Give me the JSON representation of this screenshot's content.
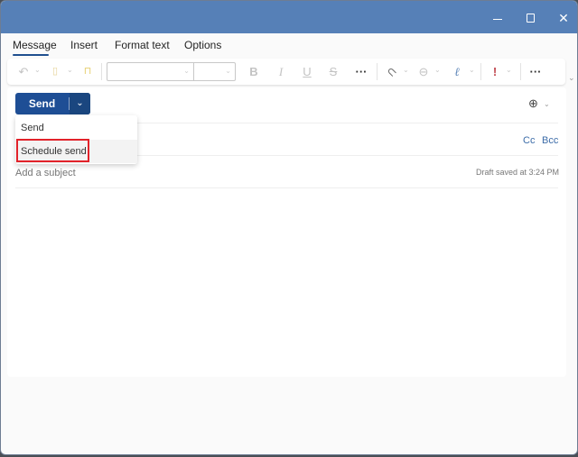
{
  "window": {
    "controls": {
      "minimize": "minimize",
      "maximize": "maximize",
      "close": "close"
    },
    "titlebar_color": "#5680b7"
  },
  "tabs": [
    {
      "label": "Message",
      "active": true
    },
    {
      "label": "Insert",
      "active": false
    },
    {
      "label": "Format text",
      "active": false
    },
    {
      "label": "Options",
      "active": false
    }
  ],
  "ribbon": {
    "icons": {
      "undo": "↶",
      "paste": "📋",
      "format_painter": "🖌",
      "bold": "B",
      "italic": "I",
      "underline": "U",
      "strikethrough": "S",
      "more_format": "···",
      "attach": "📎",
      "link": "⊖",
      "signature": "✍",
      "importance": "!",
      "more": "···"
    },
    "font_value": "",
    "size_value": ""
  },
  "compose": {
    "send_label": "Send",
    "cc_label": "Cc",
    "bcc_label": "Bcc",
    "subject_placeholder": "Add a subject",
    "draft_status": "Draft saved at 3:24 PM"
  },
  "send_menu": {
    "items": [
      {
        "label": "Send"
      },
      {
        "label": "Schedule send",
        "highlighted": true
      }
    ],
    "highlight_color": "#e2222a"
  },
  "colors": {
    "accent": "#1e4e95",
    "link": "#3c6ca8"
  }
}
